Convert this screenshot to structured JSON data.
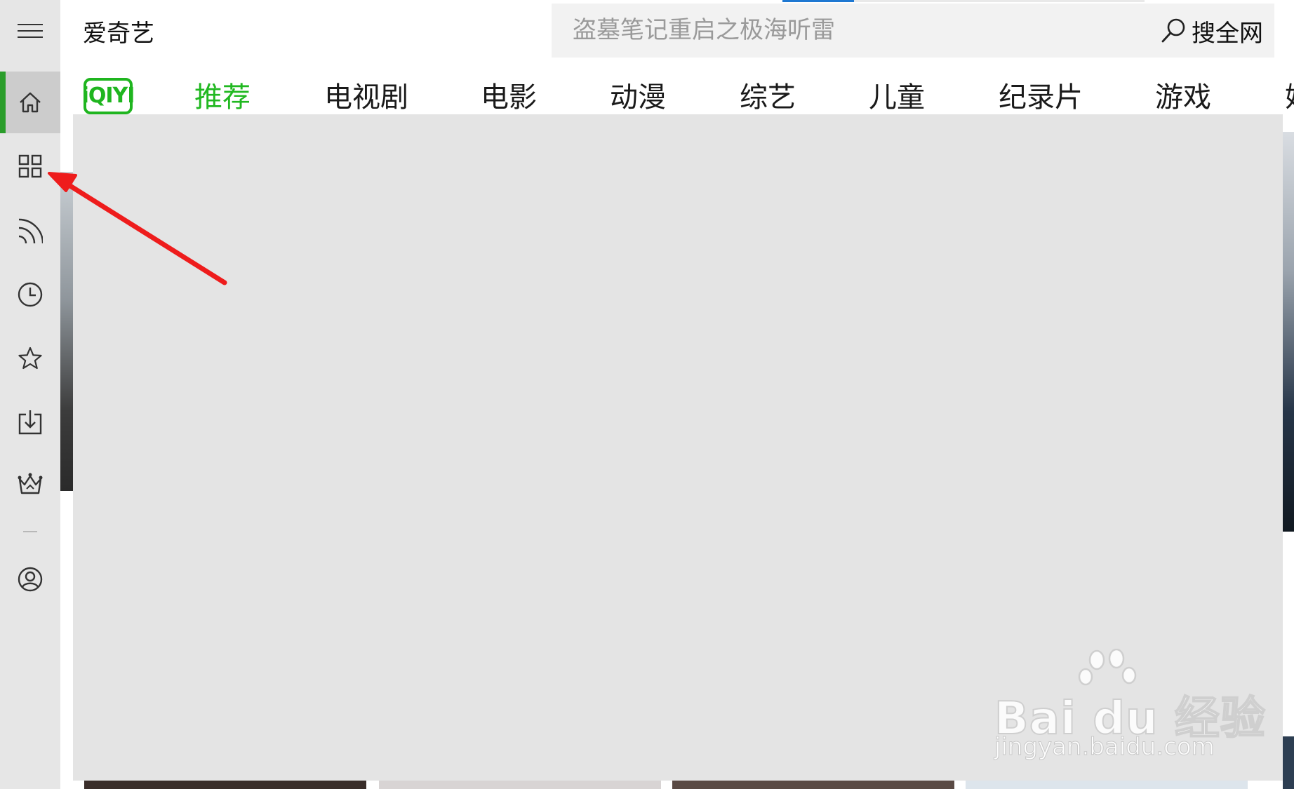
{
  "app": {
    "title": "爱奇艺"
  },
  "search": {
    "placeholder": "盗墓笔记重启之极海听雷",
    "button_label": "搜全网",
    "button_icon": "search-icon"
  },
  "logo": {
    "text": "iQIYI",
    "color": "#1fb51f"
  },
  "nav": {
    "tabs": [
      {
        "label": "推荐",
        "active": true
      },
      {
        "label": "电视剧"
      },
      {
        "label": "电影"
      },
      {
        "label": "动漫"
      },
      {
        "label": "综艺"
      },
      {
        "label": "儿童"
      },
      {
        "label": "纪录片"
      },
      {
        "label": "游戏"
      },
      {
        "label": "娱"
      }
    ],
    "active_color": "#20b820"
  },
  "sidebar": {
    "items": [
      {
        "icon": "menu-icon"
      },
      {
        "icon": "home-icon",
        "active": true
      },
      {
        "icon": "category-grid-icon"
      },
      {
        "icon": "subscription-feed-icon"
      },
      {
        "icon": "history-clock-icon"
      },
      {
        "icon": "favorites-star-icon"
      },
      {
        "icon": "download-icon"
      },
      {
        "icon": "vip-crown-icon"
      },
      {
        "icon": "user-account-icon"
      }
    ],
    "accent_color": "#2a9d2a"
  },
  "annotation": {
    "arrow_color": "#ee1c1c"
  },
  "watermark": {
    "brand": "Bai  du 经验",
    "url": "jingyan.baidu.com"
  }
}
